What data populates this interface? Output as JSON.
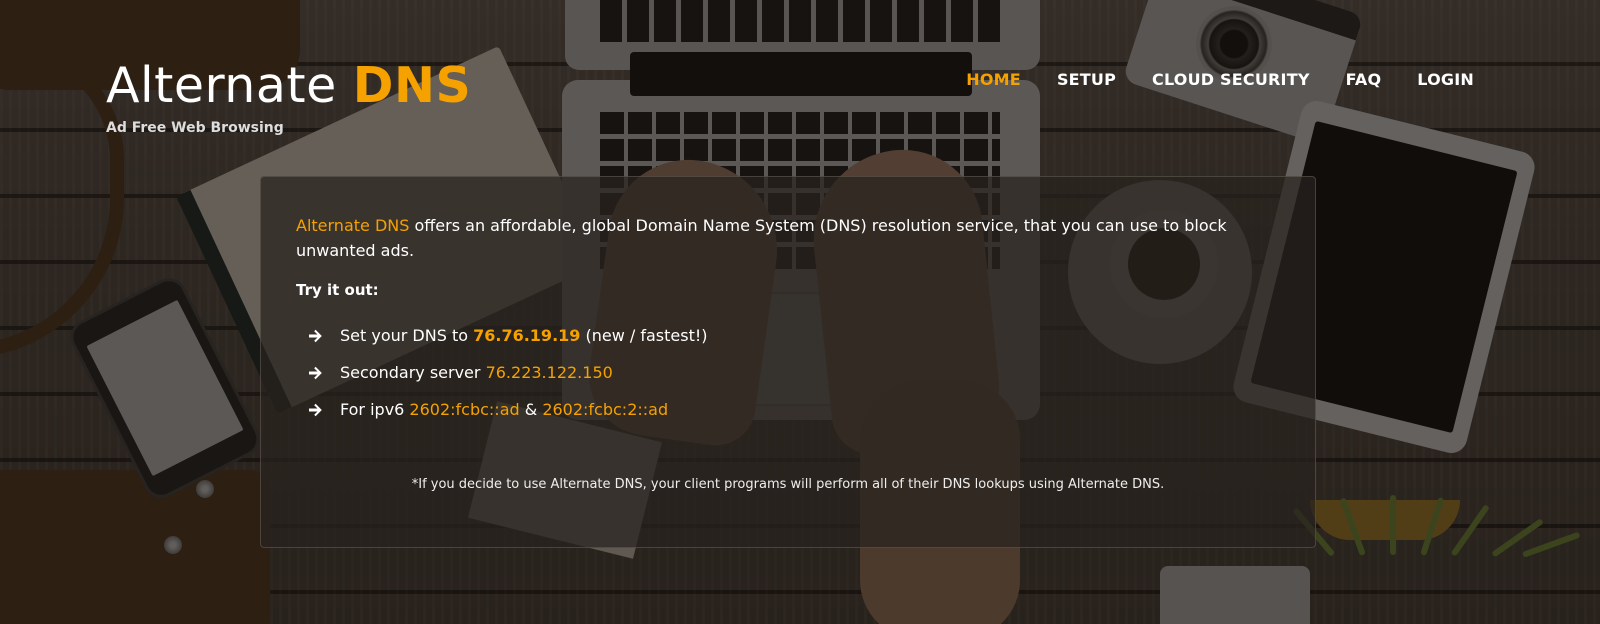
{
  "header": {
    "logo_text": "Alternate",
    "logo_accent": "DNS",
    "tagline": "Ad Free Web Browsing",
    "nav": [
      {
        "label": "HOME",
        "active": true
      },
      {
        "label": "SETUP",
        "active": false
      },
      {
        "label": "CLOUD SECURITY",
        "active": false
      },
      {
        "label": "FAQ",
        "active": false
      },
      {
        "label": "LOGIN",
        "active": false
      }
    ]
  },
  "main": {
    "intro_brand": "Alternate DNS",
    "intro_text": " offers an affordable, global Domain Name System (DNS) resolution service, that you can use to block unwanted ads.",
    "try_heading": "Try it out:",
    "items": [
      {
        "prefix": "Set your DNS to ",
        "value": "76.76.19.19",
        "suffix": " (new / fastest!)"
      },
      {
        "prefix": "Secondary server ",
        "value": "76.223.122.150",
        "suffix": ""
      },
      {
        "prefix": "For ipv6 ",
        "value": "2602:fcbc::ad",
        "middle": " & ",
        "value2": "2602:fcbc:2::ad"
      }
    ],
    "footnote": "*If you decide to use Alternate DNS, your client programs will perform all of their DNS lookups using Alternate DNS."
  },
  "colors": {
    "accent": "#f5a100",
    "text": "#ffffff"
  },
  "icons": {
    "list_bullet": "arrow-right-icon"
  }
}
